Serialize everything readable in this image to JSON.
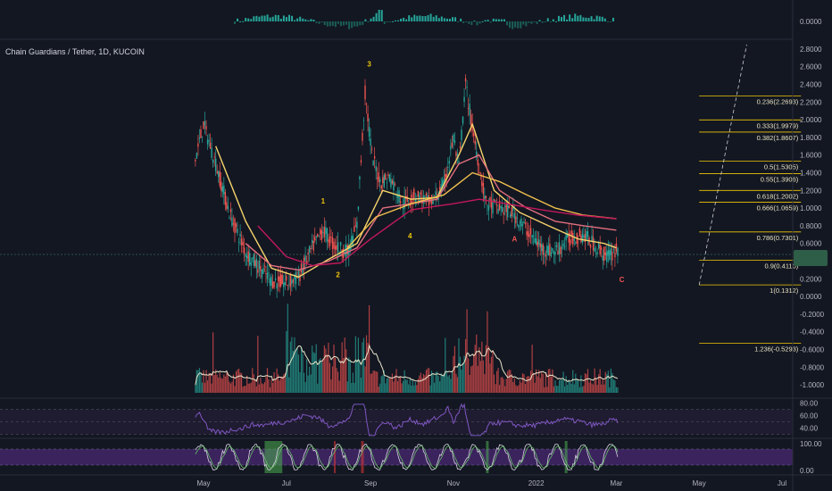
{
  "header": {
    "symbol_title": "Chain Guardians / Tether, 1D, KUCOIN"
  },
  "colors": {
    "background": "#131722",
    "up": "#26a69a",
    "down": "#ef5350",
    "axis_text": "#b2b5be",
    "fib": "#f0c808",
    "wave_label": "#f0c808",
    "corrective_label": "#ef5350",
    "last_price_bg": "#2e5d48",
    "rsi_line": "#7e57c2",
    "stoch_band": "#4a2a72",
    "volume_sma": "#e8e4c8"
  },
  "chart_data": [
    {
      "panel": "oscillator-top",
      "type": "bar",
      "axis_tick_labels": [
        "0.0000"
      ],
      "note_text": ""
    },
    {
      "panel": "price",
      "type": "line",
      "x_ticks": [
        "May",
        "Jul",
        "Sep",
        "Nov",
        "2022",
        "Mar",
        "May",
        "Jul"
      ],
      "y_ticks": [
        "2.8000",
        "2.6000",
        "2.4000",
        "2.2000",
        "2.0000",
        "1.8000",
        "1.6000",
        "1.4000",
        "1.2000",
        "1.0000",
        "0.8000",
        "0.6000",
        "0.4000",
        "0.2000",
        "0.0000",
        "-0.2000",
        "-0.4000",
        "-0.6000",
        "-0.8000",
        "-1.0000"
      ],
      "ylim": [
        -1.05,
        2.85
      ],
      "series": [
        {
          "role": "close",
          "x": [
            "2021-04-25",
            "2021-05-01",
            "2021-05-10",
            "2021-05-20",
            "2021-06-01",
            "2021-06-10",
            "2021-06-20",
            "2021-07-01",
            "2021-07-10",
            "2021-07-20",
            "2021-07-28",
            "2021-08-05",
            "2021-08-15",
            "2021-08-22",
            "2021-08-28",
            "2021-09-02",
            "2021-09-08",
            "2021-09-15",
            "2021-09-25",
            "2021-10-05",
            "2021-10-15",
            "2021-10-25",
            "2021-11-01",
            "2021-11-05",
            "2021-11-10",
            "2021-11-15",
            "2021-11-25",
            "2021-12-05",
            "2021-12-15",
            "2021-12-25",
            "2022-01-05",
            "2022-01-15",
            "2022-01-25",
            "2022-02-05",
            "2022-02-15",
            "2022-02-22",
            "2022-03-01"
          ],
          "y": [
            1.55,
            1.95,
            1.5,
            0.95,
            0.5,
            0.35,
            0.18,
            0.15,
            0.22,
            0.55,
            0.75,
            0.58,
            0.5,
            0.8,
            2.3,
            1.6,
            1.3,
            1.35,
            1.05,
            1.15,
            1.05,
            1.25,
            1.8,
            1.45,
            2.4,
            1.9,
            1.05,
            1.0,
            0.95,
            0.75,
            0.55,
            0.5,
            0.65,
            0.7,
            0.55,
            0.45,
            0.52
          ]
        },
        {
          "role": "ma-fast",
          "color": "#f5d36b",
          "x": [
            "2021-05-10",
            "2021-06-01",
            "2021-06-20",
            "2021-07-10",
            "2021-08-01",
            "2021-08-22",
            "2021-09-10",
            "2021-10-01",
            "2021-10-20",
            "2021-11-05",
            "2021-11-15",
            "2021-12-01",
            "2021-12-20",
            "2022-01-10",
            "2022-02-01",
            "2022-02-20",
            "2022-03-01"
          ],
          "y": [
            1.7,
            0.85,
            0.32,
            0.22,
            0.42,
            0.6,
            1.2,
            1.1,
            1.12,
            1.6,
            1.95,
            1.2,
            0.95,
            0.8,
            0.65,
            0.6,
            0.55
          ]
        },
        {
          "role": "ma-medium",
          "color": "#e36f7f",
          "x": [
            "2021-06-01",
            "2021-06-20",
            "2021-07-10",
            "2021-08-01",
            "2021-08-22",
            "2021-09-10",
            "2021-10-01",
            "2021-10-20",
            "2021-11-05",
            "2021-11-20",
            "2021-12-05",
            "2021-12-25",
            "2022-01-15",
            "2022-02-05",
            "2022-03-01"
          ],
          "y": [
            0.6,
            0.35,
            0.3,
            0.4,
            0.55,
            1.0,
            1.05,
            1.1,
            1.5,
            1.6,
            1.2,
            1.0,
            0.85,
            0.8,
            0.75
          ]
        },
        {
          "role": "ma-slow",
          "color": "#f2c14e",
          "x": [
            "2021-08-15",
            "2021-09-05",
            "2021-10-01",
            "2021-10-25",
            "2021-11-15",
            "2021-12-05",
            "2021-12-25",
            "2022-01-15",
            "2022-02-05",
            "2022-03-01"
          ],
          "y": [
            0.55,
            0.9,
            1.05,
            1.15,
            1.4,
            1.3,
            1.15,
            1.0,
            0.92,
            0.88
          ]
        },
        {
          "role": "ma-long",
          "color": "#c2185b",
          "x": [
            "2021-06-10",
            "2021-07-01",
            "2021-07-20",
            "2021-08-10",
            "2021-09-01",
            "2021-10-01",
            "2021-11-01",
            "2021-11-20",
            "2021-12-10",
            "2022-01-05",
            "2022-02-01",
            "2022-03-01"
          ],
          "y": [
            0.8,
            0.45,
            0.35,
            0.38,
            0.65,
            0.98,
            1.05,
            1.1,
            1.05,
            0.98,
            0.92,
            0.88
          ]
        }
      ],
      "wave_labels": [
        {
          "text": "1",
          "x": "2021-07-28",
          "y": 1.05,
          "color": "#f0c808"
        },
        {
          "text": "2",
          "x": "2021-08-08",
          "y": 0.22,
          "color": "#f0c808"
        },
        {
          "text": "3",
          "x": "2021-08-31",
          "y": 2.6,
          "color": "#f0c808"
        },
        {
          "text": "4",
          "x": "2021-09-30",
          "y": 0.66,
          "color": "#f0c808"
        },
        {
          "text": "A",
          "x": "2021-12-16",
          "y": 0.62,
          "color": "#ef5350"
        },
        {
          "text": "C",
          "x": "2022-03-05",
          "y": 0.16,
          "color": "#ef5350"
        }
      ],
      "fib_levels": [
        {
          "label": "0.236(2.2693)",
          "value": 2.2693
        },
        {
          "label": "0.333(1.9979)",
          "value": 1.9979
        },
        {
          "label": "0.382(1.8607)",
          "value": 1.8607
        },
        {
          "label": "0.5(1.5305)",
          "value": 1.5305
        },
        {
          "label": "0.55(1.3906)",
          "value": 1.3906
        },
        {
          "label": "0.618(1.2002)",
          "value": 1.2002
        },
        {
          "label": "0.666(1.0659)",
          "value": 1.0659
        },
        {
          "label": "0.786(0.7301)",
          "value": 0.7301
        },
        {
          "label": "0.9(0.4110)",
          "value": 0.411
        },
        {
          "label": "1(0.1312)",
          "value": 0.1312
        },
        {
          "label": "1.236(-0.5293)",
          "value": -0.5293
        }
      ],
      "fib_start": "2022-05-01",
      "fib_end": "2022-07-15",
      "trend_line": {
        "x": [
          "2022-05-01",
          "2022-06-05"
        ],
        "y": [
          0.13,
          2.85
        ]
      },
      "last_price_line": 0.56
    },
    {
      "panel": "volume",
      "type": "bar",
      "note": "volume bars with moving average overlay"
    },
    {
      "panel": "rsi",
      "type": "line",
      "y_ticks": [
        "80.00",
        "60.00",
        "40.00"
      ],
      "ylim": [
        25,
        85
      ],
      "bands": [
        70,
        50,
        30
      ]
    },
    {
      "panel": "stoch",
      "type": "line",
      "y_ticks": [
        "100.00",
        "0.00"
      ],
      "ylim": [
        -10,
        110
      ],
      "bands": [
        80,
        20
      ],
      "highlight_zones": [
        {
          "from": "2021-06-15",
          "to": "2021-06-28",
          "color": "green"
        },
        {
          "from": "2021-11-25",
          "to": "2021-11-27",
          "color": "green"
        },
        {
          "from": "2022-01-22",
          "to": "2022-01-24",
          "color": "green"
        },
        {
          "from": "2021-08-05",
          "to": "2021-08-06",
          "color": "red"
        },
        {
          "from": "2021-08-25",
          "to": "2021-08-27",
          "color": "red"
        }
      ]
    }
  ]
}
